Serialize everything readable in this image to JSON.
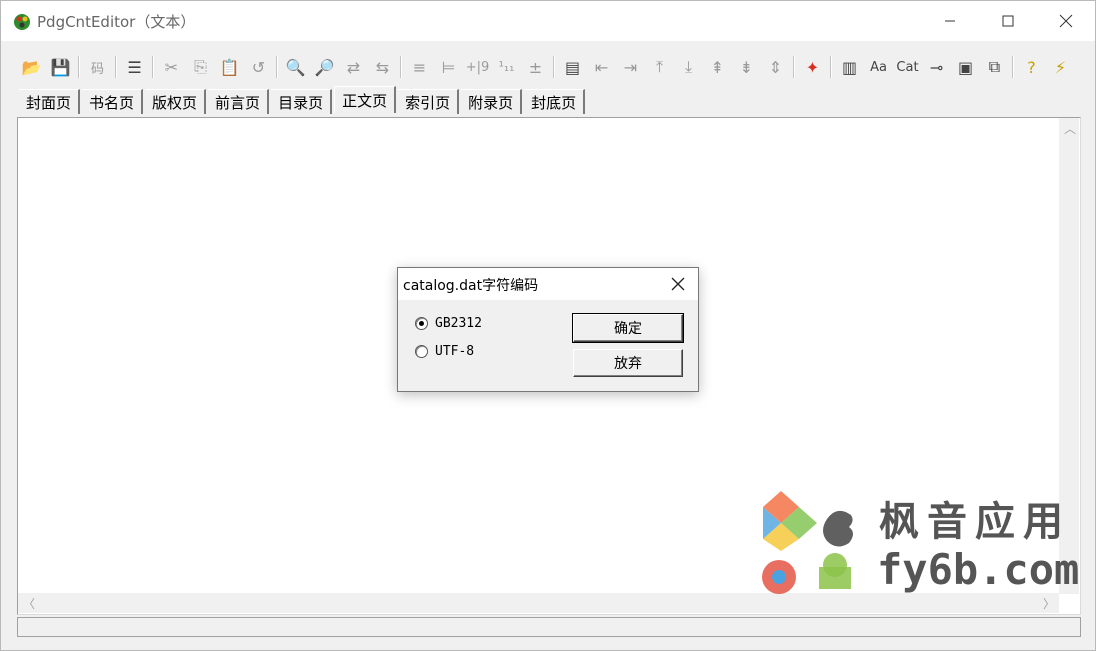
{
  "window": {
    "title": "PdgCntEditor（文本）",
    "controls": [
      "minimize",
      "maximize",
      "close"
    ]
  },
  "toolbar": {
    "buttons": [
      {
        "name": "open-folder-icon",
        "glyph": "📂",
        "enabled": true
      },
      {
        "name": "save-icon",
        "glyph": "💾",
        "enabled": true
      },
      {
        "name": "encoding-button",
        "label": "码",
        "enabled": false
      },
      {
        "name": "catalog-tree-icon",
        "glyph": "☰",
        "enabled": true
      },
      {
        "name": "cut-icon",
        "glyph": "✂",
        "enabled": false
      },
      {
        "name": "copy-icon",
        "glyph": "⎘",
        "enabled": false
      },
      {
        "name": "paste-icon",
        "glyph": "📋",
        "enabled": true
      },
      {
        "name": "undo-icon",
        "glyph": "↺",
        "enabled": false
      },
      {
        "name": "find-icon",
        "glyph": "🔍",
        "enabled": false
      },
      {
        "name": "find-next-icon",
        "glyph": "🔎",
        "enabled": false
      },
      {
        "name": "replace-icon",
        "glyph": "⇄",
        "enabled": false
      },
      {
        "name": "replace-all-icon",
        "glyph": "⇆",
        "enabled": false
      },
      {
        "name": "align-left-icon",
        "glyph": "≡",
        "enabled": false
      },
      {
        "name": "indent-icon",
        "glyph": "⊨",
        "enabled": false
      },
      {
        "name": "page-offset-icon",
        "label": "+|9",
        "enabled": false
      },
      {
        "name": "page-number-icon",
        "label": "¹₁₁",
        "enabled": false
      },
      {
        "name": "plus-minus-icon",
        "glyph": "±",
        "enabled": false
      },
      {
        "name": "page-view-icon",
        "glyph": "▤",
        "enabled": true
      },
      {
        "name": "level-up-icon",
        "glyph": "⇤",
        "enabled": false
      },
      {
        "name": "level-down-icon",
        "glyph": "⇥",
        "enabled": false
      },
      {
        "name": "move-up-icon",
        "glyph": "⤒",
        "enabled": false
      },
      {
        "name": "move-down-icon",
        "glyph": "⤓",
        "enabled": false
      },
      {
        "name": "merge-up-icon",
        "glyph": "⇞",
        "enabled": false
      },
      {
        "name": "merge-down-icon",
        "glyph": "⇟",
        "enabled": false
      },
      {
        "name": "expand-icon",
        "glyph": "⇕",
        "enabled": false
      },
      {
        "name": "pdf-icon",
        "glyph": "✦",
        "enabled": true,
        "color": "#d83020"
      },
      {
        "name": "columns-icon",
        "glyph": "▥",
        "enabled": true
      },
      {
        "name": "font-icon",
        "label": "Aa",
        "enabled": true
      },
      {
        "name": "cat-button",
        "label": "Cat",
        "enabled": true
      },
      {
        "name": "pin-icon",
        "glyph": "⊸",
        "enabled": true
      },
      {
        "name": "window-icon",
        "glyph": "▣",
        "enabled": true
      },
      {
        "name": "export-icon",
        "glyph": "⧉",
        "enabled": true
      },
      {
        "name": "help-icon",
        "glyph": "?",
        "enabled": true,
        "color": "#c8a000"
      },
      {
        "name": "about-icon",
        "glyph": "⚡",
        "enabled": true,
        "color": "#c8a000"
      }
    ]
  },
  "tabs": [
    {
      "label": "封面页",
      "active": false
    },
    {
      "label": "书名页",
      "active": false
    },
    {
      "label": "版权页",
      "active": false
    },
    {
      "label": "前言页",
      "active": false
    },
    {
      "label": "目录页",
      "active": false
    },
    {
      "label": "正文页",
      "active": true
    },
    {
      "label": "索引页",
      "active": false
    },
    {
      "label": "附录页",
      "active": false
    },
    {
      "label": "封底页",
      "active": false
    }
  ],
  "dialog": {
    "title": "catalog.dat字符编码",
    "options": [
      {
        "label": "GB2312",
        "selected": true
      },
      {
        "label": "UTF-8",
        "selected": false
      }
    ],
    "ok_label": "确定",
    "cancel_label": "放弃"
  },
  "watermark": {
    "text_cn": "枫音应用",
    "text_en": "fy6b.com"
  },
  "colors": {
    "background": "#f0f0f0",
    "content": "#ffffff",
    "accent_pdf": "#d83020"
  }
}
